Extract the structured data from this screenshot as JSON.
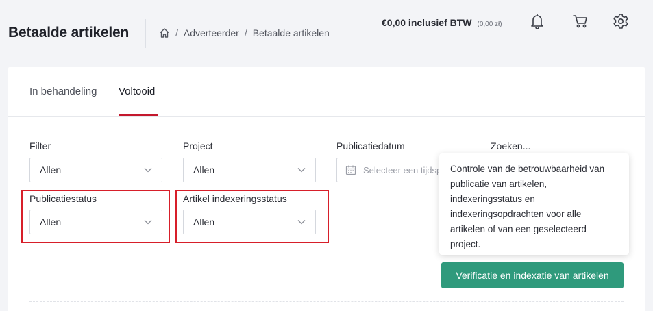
{
  "header": {
    "title": "Betaalde artikelen",
    "breadcrumb": {
      "items": [
        "Adverteerder",
        "Betaalde artikelen"
      ]
    },
    "balance": {
      "main": "€0,00 inclusief BTW",
      "sub": "(0,00 zł)"
    },
    "icons": [
      "bell-icon",
      "cart-icon",
      "gear-icon"
    ]
  },
  "tabs": [
    {
      "label": "In behandeling",
      "active": false
    },
    {
      "label": "Voltooid",
      "active": true
    }
  ],
  "filters": {
    "filter": {
      "label": "Filter",
      "value": "Allen"
    },
    "project": {
      "label": "Project",
      "value": "Allen"
    },
    "publication_date": {
      "label": "Publicatiedatum",
      "placeholder": "Selecteer een tijdsperiode"
    },
    "search": {
      "label": "Zoeken..."
    },
    "publication_status": {
      "label": "Publicatiestatus",
      "value": "Allen"
    },
    "indexing_status": {
      "label": "Artikel indexeringsstatus",
      "value": "Allen"
    }
  },
  "tooltip": {
    "text": "Controle van de betrouwbaarheid van publicatie van artikelen, indexeringsstatus en indexeringsopdrachten voor alle artikelen of van een geselecteerd project."
  },
  "verify_button": {
    "label": "Verificatie en indexatie van artikelen"
  },
  "colors": {
    "accent": "#c4182d",
    "highlight": "#d71f2a",
    "button": "#2f9a7c",
    "background": "#f3f4f7"
  }
}
